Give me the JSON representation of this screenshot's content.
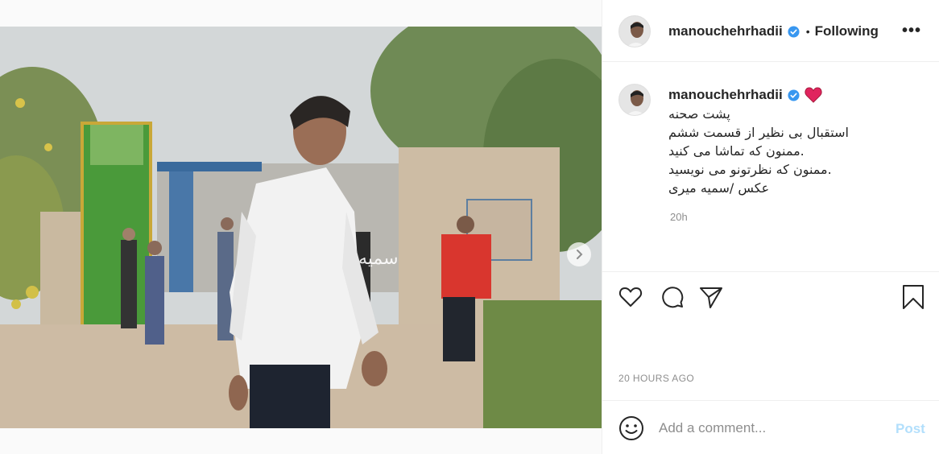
{
  "header": {
    "username": "manouchehrhadii",
    "separator": "•",
    "follow_status": "Following",
    "more_label": "•••"
  },
  "media": {
    "current_image": 1,
    "image_count": 2,
    "watermark": "SOMAYEH MIRI"
  },
  "caption": {
    "username": "manouchehrhadii",
    "lines": [
      "پشت صحنه",
      "استقبال بی نظیر از قسمت ششم",
      "ممنون که تماشا می کنید.",
      "ممنون که نظرتونو می نویسید.",
      "عکس /سمیه میری"
    ],
    "time": "20h"
  },
  "actions": {
    "like_icon": "heart-outline-icon",
    "comment_icon": "comment-bubble-icon",
    "share_icon": "paper-plane-icon",
    "save_icon": "bookmark-icon"
  },
  "timestamp": "20 HOURS AGO",
  "comment_box": {
    "placeholder": "Add a comment...",
    "post_label": "Post"
  },
  "colors": {
    "verified": "#3897f0",
    "post_disabled": "#b2dffc",
    "muted": "#8e8e8e",
    "heart": "#e0245e"
  }
}
